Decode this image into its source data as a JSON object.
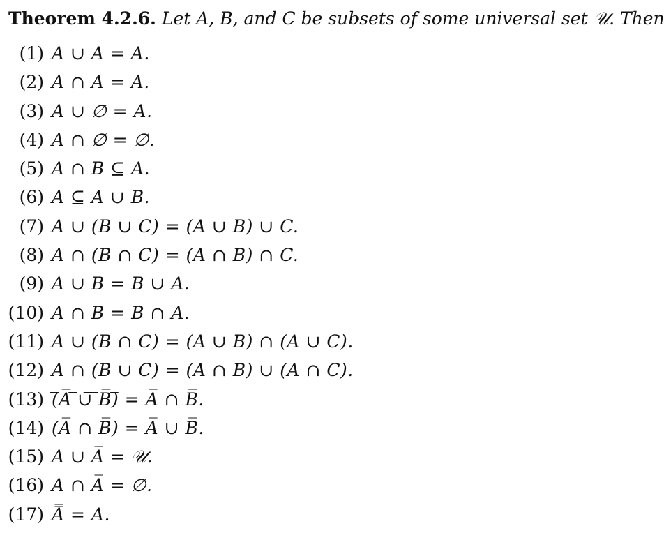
{
  "theorem": {
    "label": "Theorem 4.2.6.",
    "intro": "Let A, B, and C be subsets of some universal set 𝒰. Then:"
  },
  "items": [
    {
      "number": "(1)",
      "formula": "A ∪ A = A."
    },
    {
      "number": "(2)",
      "formula": "A ∩ A = A."
    },
    {
      "number": "(3)",
      "formula": "A ∪ ∅ = A."
    },
    {
      "number": "(4)",
      "formula": "A ∩ ∅ = ∅."
    },
    {
      "number": "(5)",
      "formula": "A ∩ B ⊆ A."
    },
    {
      "number": "(6)",
      "formula": "A ⊆ A ∪ B."
    },
    {
      "number": "(7)",
      "formula": "A ∪ (B ∪ C) = (A ∪ B) ∪ C."
    },
    {
      "number": "(8)",
      "formula": "A ∩ (B ∩ C) = (A ∩ B) ∩ C."
    },
    {
      "number": "(9)",
      "formula": "A ∪ B = B ∪ A."
    },
    {
      "number": "(10)",
      "formula": "A ∩ B = B ∩ A."
    },
    {
      "number": "(11)",
      "formula": "A ∪ (B ∩ C) = (A ∪ B) ∩ (A ∪ C)."
    },
    {
      "number": "(12)",
      "formula": "A ∩ (B ∪ C) = (A ∩ B) ∪ (A ∩ C)."
    },
    {
      "number": "(13)",
      "formula": "(̅A̅ ̅∪̅ ̅B̅)̅ = A̅ ∩ B̅."
    },
    {
      "number": "(14)",
      "formula": "(̅A̅ ̅∩̅ ̅B̅)̅ = A̅ ∪ B̅."
    },
    {
      "number": "(15)",
      "formula": "A ∪ A̅ = 𝒰."
    },
    {
      "number": "(16)",
      "formula": "A ∩ A̅ = ∅."
    },
    {
      "number": "(17)",
      "formula": "A̿ = A."
    }
  ]
}
